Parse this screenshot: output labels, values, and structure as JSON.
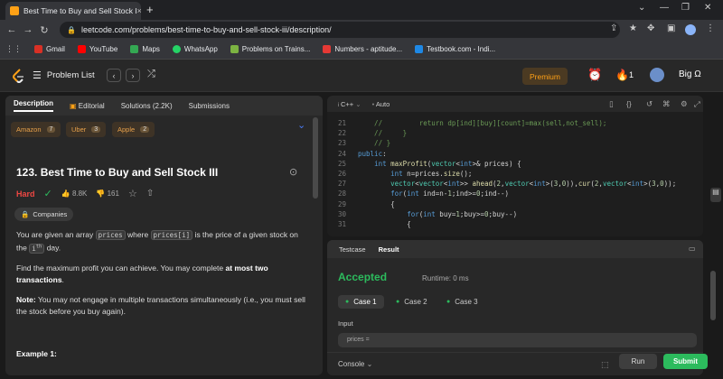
{
  "browser": {
    "tab_title": "Best Time to Buy and Sell Stock I",
    "tab_close": "×",
    "new_tab": "+",
    "url": "leetcode.com/problems/best-time-to-buy-and-sell-stock-iii/description/",
    "bookmarks": [
      {
        "label": "Gmail",
        "color": "#d93025"
      },
      {
        "label": "YouTube",
        "color": "#ff0000"
      },
      {
        "label": "Maps",
        "color": "#34a853"
      },
      {
        "label": "WhatsApp",
        "color": "#25d366"
      },
      {
        "label": "Problems on Trains...",
        "color": "#7cb342"
      },
      {
        "label": "Numbers - aptitude...",
        "color": "#e53935"
      },
      {
        "label": "Testbook.com - Indi...",
        "color": "#1e88e5"
      }
    ]
  },
  "nav": {
    "problem_list": "Problem List",
    "premium": "Premium",
    "streak": "1",
    "user": "Big Ω"
  },
  "left_tabs": [
    "Description",
    "Editorial",
    "Solutions (2.2K)",
    "Submissions"
  ],
  "companies": [
    {
      "name": "Amazon",
      "count": "7"
    },
    {
      "name": "Uber",
      "count": "3"
    },
    {
      "name": "Apple",
      "count": "2"
    }
  ],
  "problem": {
    "title": "123. Best Time to Buy and Sell Stock III",
    "difficulty": "Hard",
    "likes": "8.8K",
    "dislikes": "161",
    "companies_label": "Companies",
    "p1_a": "You are given an array ",
    "p1_code1": "prices",
    "p1_b": " where ",
    "p1_code2": "prices[i]",
    "p1_c": " is the price of a given stock on the ",
    "p1_code3": "i",
    "p1_sup": "th",
    "p1_d": " day.",
    "p2_a": "Find the maximum profit you can achieve. You may complete ",
    "p2_bold": "at most two transactions",
    "p2_b": ".",
    "p3_bold": "Note:",
    "p3_text": " You may not engage in multiple transactions simultaneously (i.e., you must sell the stock before you buy again).",
    "example": "Example 1:"
  },
  "editor": {
    "lang": "C++",
    "mode": "Auto"
  },
  "code_lines": [
    {
      "n": "21",
      "html": "<span class='cm'>    //         return dp[ind][buy][count]=max(sell,not_sell);</span>"
    },
    {
      "n": "22",
      "html": "<span class='cm'>    //     }</span>"
    },
    {
      "n": "23",
      "html": "<span class='cm'>    // }</span>"
    },
    {
      "n": "24",
      "html": "<span class='kw'>public</span><span class='tx'>:</span>"
    },
    {
      "n": "25",
      "html": "<span class='tx'>    </span><span class='kw'>int</span><span class='tx'> </span><span class='fn'>maxProfit</span><span class='tx'>(</span><span class='ty'>vector</span><span class='tx'>&lt;</span><span class='kw'>int</span><span class='tx'>&gt;&amp; prices) {</span>"
    },
    {
      "n": "26",
      "html": "<span class='tx'>        </span><span class='kw'>int</span><span class='tx'> n=prices.</span><span class='fn'>size</span><span class='tx'>();</span>"
    },
    {
      "n": "27",
      "html": "<span class='tx'>        </span><span class='ty'>vector</span><span class='tx'>&lt;</span><span class='ty'>vector</span><span class='tx'>&lt;</span><span class='kw'>int</span><span class='tx'>&gt;&gt; </span><span class='fn'>ahead</span><span class='tx'>(</span><span class='nu'>2</span><span class='tx'>,</span><span class='ty'>vector</span><span class='tx'>&lt;</span><span class='kw'>int</span><span class='tx'>&gt;(</span><span class='nu'>3</span><span class='tx'>,</span><span class='nu'>0</span><span class='tx'>)),</span><span class='fn'>cur</span><span class='tx'>(</span><span class='nu'>2</span><span class='tx'>,</span><span class='ty'>vector</span><span class='tx'>&lt;</span><span class='kw'>int</span><span class='tx'>&gt;(</span><span class='nu'>3</span><span class='tx'>,</span><span class='nu'>0</span><span class='tx'>));</span>"
    },
    {
      "n": "28",
      "html": "<span class='tx'>        </span><span class='kw'>for</span><span class='tx'>(</span><span class='kw'>int</span><span class='tx'> ind=n-</span><span class='nu'>1</span><span class='tx'>;ind&gt;=</span><span class='nu'>0</span><span class='tx'>;ind--)</span>"
    },
    {
      "n": "29",
      "html": "<span class='tx'>        {</span>"
    },
    {
      "n": "30",
      "html": "<span class='tx'>            </span><span class='kw'>for</span><span class='tx'>(</span><span class='kw'>int</span><span class='tx'> buy=</span><span class='nu'>1</span><span class='tx'>;buy&gt;=</span><span class='nu'>0</span><span class='tx'>;buy--)</span>"
    },
    {
      "n": "31",
      "html": "<span class='tx'>            {</span>"
    }
  ],
  "result": {
    "tabs": [
      "Testcase",
      "Result"
    ],
    "status": "Accepted",
    "runtime": "Runtime: 0 ms",
    "cases": [
      "Case 1",
      "Case 2",
      "Case 3"
    ],
    "input_label": "Input",
    "input_value": "prices =",
    "console": "Console",
    "run": "Run",
    "submit": "Submit"
  }
}
